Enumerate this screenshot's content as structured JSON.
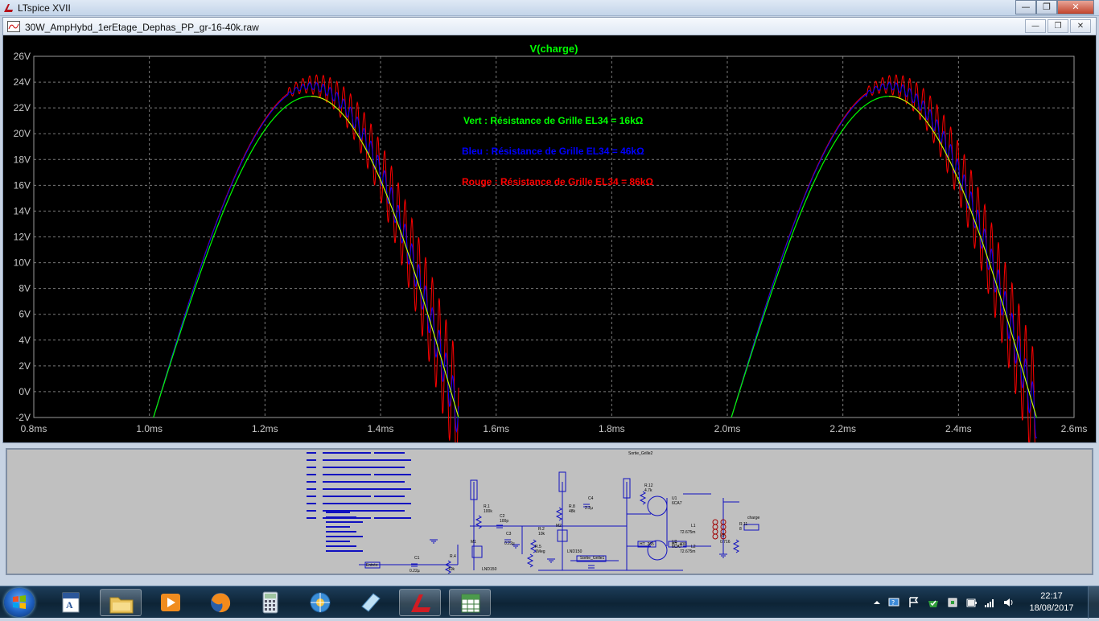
{
  "app": {
    "title": "LTspice XVII"
  },
  "window_controls": {
    "minimize": "—",
    "restore": "❐",
    "close": "✕"
  },
  "document": {
    "title": "30W_AmpHybd_1erEtage_Dephas_PP_gr-16-40k.raw"
  },
  "doc_controls": {
    "minimize": "—",
    "restore": "❐",
    "close": "✕"
  },
  "colors": {
    "plot_bg": "#000000",
    "grid": "#7a7a7a",
    "green": "#00ff00",
    "blue": "#0000ff",
    "red": "#ff0000",
    "text": "#c8c8c8"
  },
  "chart_data": {
    "type": "line",
    "title": "V(charge)",
    "xlabel": "",
    "ylabel": "",
    "xlim": [
      0.8,
      2.6
    ],
    "ylim": [
      -2,
      26
    ],
    "x_ticks": [
      "0.8ms",
      "1.0ms",
      "1.2ms",
      "1.4ms",
      "1.6ms",
      "1.8ms",
      "2.0ms",
      "2.2ms",
      "2.4ms",
      "2.6ms"
    ],
    "y_ticks": [
      "26V",
      "24V",
      "22V",
      "20V",
      "18V",
      "16V",
      "14V",
      "12V",
      "10V",
      "8V",
      "6V",
      "4V",
      "2V",
      "0V",
      "-2V"
    ],
    "grid": true,
    "annotations": [
      {
        "text": "Vert : Résistance de Grille EL34 = 16kΩ",
        "color": "#00ff00"
      },
      {
        "text": "Bleu : Résistance de Grille EL34 = 46kΩ",
        "color": "#0000ff"
      },
      {
        "text": "Rouge : Résistance de Grille EL34 = 86kΩ",
        "color": "#ff0000"
      }
    ],
    "series": [
      {
        "color": "#00ff00",
        "peak": 22.9,
        "ripple": 0
      },
      {
        "color": "#0000ff",
        "peak": 23.7,
        "ripple": 0.6
      },
      {
        "color": "#ff0000",
        "peak": 23.8,
        "ripple": 1.6
      }
    ],
    "half_wave": [
      {
        "start": 1.007,
        "peak_at": 1.28,
        "end": 1.535
      },
      {
        "start": 2.007,
        "peak_at": 2.28,
        "end": 2.535
      }
    ]
  },
  "schematic": {
    "labels": [
      "Entrée",
      "LND150",
      "LND150",
      "R.1",
      "100k",
      "C2",
      "100p",
      "R.2",
      "10k",
      "R.4",
      "10k",
      "R.5",
      "1Meg",
      "R.8",
      "48k",
      "C4",
      "2.2µ",
      "C1",
      "0.22µ",
      "C3",
      "0.22µ",
      "R.12",
      "4.7k",
      "U1",
      "6CA7",
      "U2",
      "6CA7",
      "L1",
      "72.675m",
      "L2",
      "72.675m",
      "L3",
      "0.716",
      "R.11",
      "8",
      "charge",
      "HT_265",
      "HT_400",
      "Sortie_Grille1",
      "Sortie_Grille2",
      "M1",
      "M2"
    ]
  },
  "taskbar": {
    "time": "22:17",
    "date": "18/08/2017"
  }
}
